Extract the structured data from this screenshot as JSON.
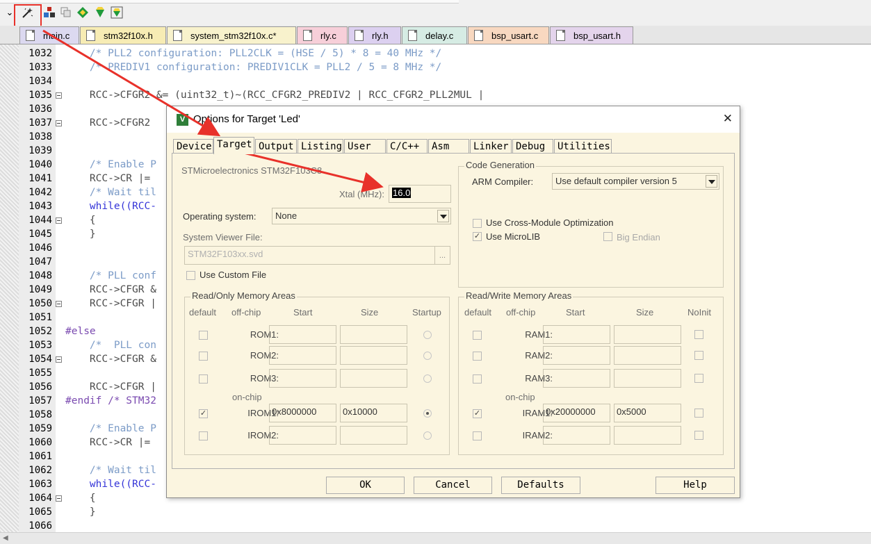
{
  "toolbar": {
    "icons": [
      "chevron-down-icon",
      "magic-wand-icon",
      "build-icon",
      "copy-target-icon",
      "diamond-icon",
      "gem-icon",
      "gem-box-icon"
    ]
  },
  "file_tabs": [
    {
      "label": "main.c",
      "color": "#dcd9f0"
    },
    {
      "label": "stm32f10x.h",
      "color": "#f7ecb4"
    },
    {
      "label": "system_stm32f10x.c*",
      "color": "#f8f2cc"
    },
    {
      "label": "rly.c",
      "color": "#f7cfd9"
    },
    {
      "label": "rly.h",
      "color": "#dcd0f0"
    },
    {
      "label": "delay.c",
      "color": "#d6ece4"
    },
    {
      "label": "bsp_usart.c",
      "color": "#f8d8c0"
    },
    {
      "label": "bsp_usart.h",
      "color": "#e4d4ec"
    }
  ],
  "editor": {
    "lines": [
      {
        "n": "1032",
        "text": "    /* PLL2 configuration: PLL2CLK = (HSE / 5) * 8 = 40 MHz */",
        "style": "comment",
        "fold": false
      },
      {
        "n": "1033",
        "text": "    /* PREDIV1 configuration: PREDIV1CLK = PLL2 / 5 = 8 MHz */",
        "style": "comment",
        "fold": false
      },
      {
        "n": "1034",
        "text": "",
        "style": "plain",
        "fold": false
      },
      {
        "n": "1035",
        "text": "    RCC->CFGR2 &= (uint32_t)~(RCC_CFGR2_PREDIV2 | RCC_CFGR2_PLL2MUL |",
        "style": "plain",
        "fold": true
      },
      {
        "n": "1036",
        "text": "",
        "style": "plain",
        "fold": false
      },
      {
        "n": "1037",
        "text": "    RCC->CFGR2",
        "style": "plain",
        "fold": true
      },
      {
        "n": "1038",
        "text": "",
        "style": "plain",
        "fold": false
      },
      {
        "n": "1039",
        "text": "",
        "style": "plain",
        "fold": false
      },
      {
        "n": "1040",
        "text": "    /* Enable P",
        "style": "comment",
        "fold": false
      },
      {
        "n": "1041",
        "text": "    RCC->CR |=",
        "style": "plain",
        "fold": false
      },
      {
        "n": "1042",
        "text": "    /* Wait til",
        "style": "comment",
        "fold": false
      },
      {
        "n": "1043",
        "text": "    while((RCC-",
        "style": "kw",
        "fold": false
      },
      {
        "n": "1044",
        "text": "    {",
        "style": "plain",
        "fold": true
      },
      {
        "n": "1045",
        "text": "    }",
        "style": "plain",
        "fold": false
      },
      {
        "n": "1046",
        "text": "",
        "style": "plain",
        "fold": false
      },
      {
        "n": "1047",
        "text": "",
        "style": "plain",
        "fold": false
      },
      {
        "n": "1048",
        "text": "    /* PLL conf",
        "style": "comment",
        "fold": false
      },
      {
        "n": "1049",
        "text": "    RCC->CFGR &",
        "style": "plain",
        "fold": false
      },
      {
        "n": "1050",
        "text": "    RCC->CFGR |",
        "style": "plain",
        "fold": true
      },
      {
        "n": "1051",
        "text": "",
        "style": "plain",
        "fold": false
      },
      {
        "n": "1052",
        "text": "#else",
        "style": "pre",
        "fold": false
      },
      {
        "n": "1053",
        "text": "    /*  PLL con",
        "style": "comment",
        "fold": false
      },
      {
        "n": "1054",
        "text": "    RCC->CFGR &",
        "style": "plain",
        "fold": true
      },
      {
        "n": "1055",
        "text": "",
        "style": "plain",
        "fold": false
      },
      {
        "n": "1056",
        "text": "    RCC->CFGR |",
        "style": "plain",
        "fold": false
      },
      {
        "n": "1057",
        "text": "#endif /* STM32",
        "style": "pre",
        "fold": false
      },
      {
        "n": "1058",
        "text": "",
        "style": "plain",
        "fold": false
      },
      {
        "n": "1059",
        "text": "    /* Enable P",
        "style": "comment",
        "fold": false
      },
      {
        "n": "1060",
        "text": "    RCC->CR |=",
        "style": "plain",
        "fold": false
      },
      {
        "n": "1061",
        "text": "",
        "style": "plain",
        "fold": false
      },
      {
        "n": "1062",
        "text": "    /* Wait til",
        "style": "comment",
        "fold": false
      },
      {
        "n": "1063",
        "text": "    while((RCC-",
        "style": "kw",
        "fold": false
      },
      {
        "n": "1064",
        "text": "    {",
        "style": "plain",
        "fold": true
      },
      {
        "n": "1065",
        "text": "    }",
        "style": "plain",
        "fold": false
      },
      {
        "n": "1066",
        "text": "",
        "style": "plain",
        "fold": false
      }
    ]
  },
  "dialog": {
    "title": "Options for Target 'Led'",
    "tabs": [
      "Device",
      "Target",
      "Output",
      "Listing",
      "User",
      "C/C++",
      "Asm",
      "Linker",
      "Debug",
      "Utilities"
    ],
    "active_tab": "Target",
    "device_name": "STMicroelectronics STM32F103C8",
    "xtal_label": "Xtal (MHz):",
    "xtal_value": "16.0",
    "os_label": "Operating system:",
    "os_value": "None",
    "svd_label": "System Viewer File:",
    "svd_value": "STM32F103xx.svd",
    "browse_label": "...",
    "custom_file_label": "Use Custom File",
    "code_gen": {
      "title": "Code Generation",
      "compiler_label": "ARM Compiler:",
      "compiler_value": "Use default compiler version 5",
      "cross_module_label": "Use Cross-Module Optimization",
      "cross_module": false,
      "microlib_label": "Use MicroLIB",
      "microlib": true,
      "big_endian_label": "Big Endian",
      "big_endian": false
    },
    "rom": {
      "title": "Read/Only Memory Areas",
      "headers": [
        "default",
        "off-chip",
        "Start",
        "Size",
        "Startup"
      ],
      "onchip_label": "on-chip",
      "rows": [
        {
          "name": "ROM1:",
          "start": "",
          "size": "",
          "default": false,
          "startup": false
        },
        {
          "name": "ROM2:",
          "start": "",
          "size": "",
          "default": false,
          "startup": false
        },
        {
          "name": "ROM3:",
          "start": "",
          "size": "",
          "default": false,
          "startup": false
        },
        {
          "name": "IROM1:",
          "start": "0x8000000",
          "size": "0x10000",
          "default": true,
          "startup": true
        },
        {
          "name": "IROM2:",
          "start": "",
          "size": "",
          "default": false,
          "startup": false
        }
      ]
    },
    "ram": {
      "title": "Read/Write Memory Areas",
      "headers": [
        "default",
        "off-chip",
        "Start",
        "Size",
        "NoInit"
      ],
      "onchip_label": "on-chip",
      "rows": [
        {
          "name": "RAM1:",
          "start": "",
          "size": "",
          "default": false,
          "noinit": false
        },
        {
          "name": "RAM2:",
          "start": "",
          "size": "",
          "default": false,
          "noinit": false
        },
        {
          "name": "RAM3:",
          "start": "",
          "size": "",
          "default": false,
          "noinit": false
        },
        {
          "name": "IRAM1:",
          "start": "0x20000000",
          "size": "0x5000",
          "default": true,
          "noinit": false
        },
        {
          "name": "IRAM2:",
          "start": "",
          "size": "",
          "default": false,
          "noinit": false
        }
      ]
    },
    "buttons": {
      "ok": "OK",
      "cancel": "Cancel",
      "defaults": "Defaults",
      "help": "Help"
    },
    "close_glyph": "✕"
  },
  "annotation": {
    "color": "#e8312a"
  }
}
